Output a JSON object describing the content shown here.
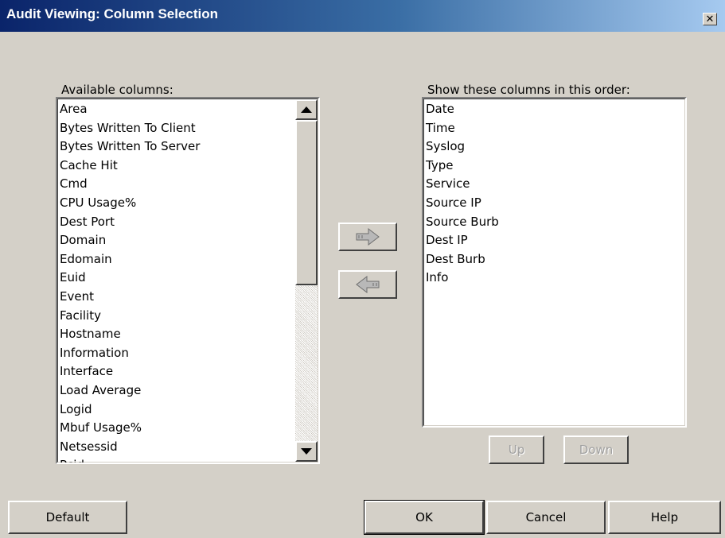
{
  "window": {
    "title": "Audit Viewing: Column Selection",
    "close_glyph": "✕"
  },
  "available": {
    "label": "Available columns:",
    "items": [
      "Area",
      "Bytes Written To Client",
      "Bytes Written To Server",
      "Cache Hit",
      "Cmd",
      "CPU Usage%",
      "Dest Port",
      "Domain",
      "Edomain",
      "Euid",
      "Event",
      "Facility",
      "Hostname",
      "Information",
      "Interface",
      "Load Average",
      "Logid",
      "Mbuf Usage%",
      "Netsessid",
      "Pcid"
    ],
    "scroll_up_icon": "arrow-up-icon",
    "scroll_down_icon": "arrow-down-icon"
  },
  "selected": {
    "label": "Show these columns in this order:",
    "items": [
      "Date",
      "Time",
      "Syslog",
      "Type",
      "Service",
      "Source IP",
      "Source Burb",
      "Dest IP",
      "Dest Burb",
      "Info"
    ]
  },
  "transfer": {
    "add_icon": "arrow-right-icon",
    "remove_icon": "arrow-left-icon"
  },
  "order_buttons": {
    "up_label": "Up",
    "down_label": "Down",
    "enabled": false
  },
  "footer": {
    "default_label": "Default",
    "ok_label": "OK",
    "cancel_label": "Cancel",
    "help_label": "Help"
  },
  "colors": {
    "dialog_face": "#d4d0c8",
    "titlebar_start": "#0a246a",
    "titlebar_end": "#a6caf0",
    "disabled_text": "#a0a0a0"
  }
}
